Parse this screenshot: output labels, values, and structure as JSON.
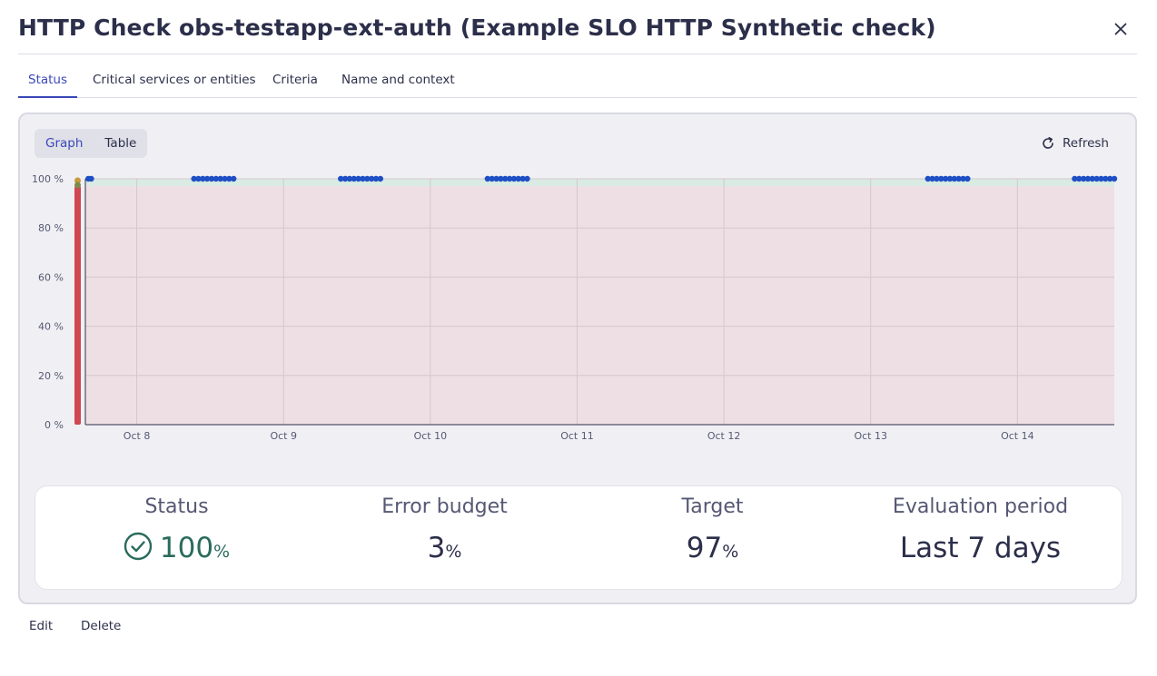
{
  "dialog": {
    "title": "HTTP Check obs-testapp-ext-auth (Example SLO HTTP Synthetic check)",
    "close_icon": "close-icon"
  },
  "tabs": [
    {
      "label": "Status",
      "active": true
    },
    {
      "label": "Critical services or entities",
      "active": false
    },
    {
      "label": "Criteria",
      "active": false
    },
    {
      "label": "Name and context",
      "active": false
    }
  ],
  "view_toggle": {
    "graph_label": "Graph",
    "table_label": "Table",
    "selected": "Graph"
  },
  "refresh": {
    "label": "Refresh",
    "icon": "refresh-icon"
  },
  "chart_data": {
    "type": "scatter",
    "y_ticks": [
      "100 %",
      "80 %",
      "60 %",
      "40 %",
      "20 %",
      "0 %"
    ],
    "ylim": [
      0,
      100
    ],
    "x_ticks": [
      "Oct 8",
      "Oct 9",
      "Oct 10",
      "Oct 11",
      "Oct 12",
      "Oct 13",
      "Oct 14"
    ],
    "xlim_days": [
      7.65,
      14.66
    ],
    "grid": true,
    "target_percent": 97,
    "colors": {
      "points": "#1f4fc4",
      "error_band": "#eddfe3",
      "ok_band": "#d9ebe3",
      "bar": "#d0474f"
    },
    "series": [
      {
        "values": [
          {
            "x": 7.67,
            "y": 100
          },
          {
            "x": 7.69,
            "y": 100
          },
          {
            "x": 8.39,
            "y": 100
          },
          {
            "x": 8.42,
            "y": 100
          },
          {
            "x": 8.45,
            "y": 100
          },
          {
            "x": 8.48,
            "y": 100
          },
          {
            "x": 8.51,
            "y": 100
          },
          {
            "x": 8.54,
            "y": 100
          },
          {
            "x": 8.57,
            "y": 100
          },
          {
            "x": 8.6,
            "y": 100
          },
          {
            "x": 8.63,
            "y": 100
          },
          {
            "x": 8.66,
            "y": 100
          },
          {
            "x": 9.39,
            "y": 100
          },
          {
            "x": 9.42,
            "y": 100
          },
          {
            "x": 9.45,
            "y": 100
          },
          {
            "x": 9.48,
            "y": 100
          },
          {
            "x": 9.51,
            "y": 100
          },
          {
            "x": 9.54,
            "y": 100
          },
          {
            "x": 9.57,
            "y": 100
          },
          {
            "x": 9.6,
            "y": 100
          },
          {
            "x": 9.63,
            "y": 100
          },
          {
            "x": 9.66,
            "y": 100
          },
          {
            "x": 10.39,
            "y": 100
          },
          {
            "x": 10.42,
            "y": 100
          },
          {
            "x": 10.45,
            "y": 100
          },
          {
            "x": 10.48,
            "y": 100
          },
          {
            "x": 10.51,
            "y": 100
          },
          {
            "x": 10.54,
            "y": 100
          },
          {
            "x": 10.57,
            "y": 100
          },
          {
            "x": 10.6,
            "y": 100
          },
          {
            "x": 10.63,
            "y": 100
          },
          {
            "x": 10.66,
            "y": 100
          },
          {
            "x": 13.39,
            "y": 100
          },
          {
            "x": 13.42,
            "y": 100
          },
          {
            "x": 13.45,
            "y": 100
          },
          {
            "x": 13.48,
            "y": 100
          },
          {
            "x": 13.51,
            "y": 100
          },
          {
            "x": 13.54,
            "y": 100
          },
          {
            "x": 13.57,
            "y": 100
          },
          {
            "x": 13.6,
            "y": 100
          },
          {
            "x": 13.63,
            "y": 100
          },
          {
            "x": 13.66,
            "y": 100
          },
          {
            "x": 14.39,
            "y": 100
          },
          {
            "x": 14.42,
            "y": 100
          },
          {
            "x": 14.45,
            "y": 100
          },
          {
            "x": 14.48,
            "y": 100
          },
          {
            "x": 14.51,
            "y": 100
          },
          {
            "x": 14.54,
            "y": 100
          },
          {
            "x": 14.57,
            "y": 100
          },
          {
            "x": 14.6,
            "y": 100
          },
          {
            "x": 14.63,
            "y": 100
          },
          {
            "x": 14.66,
            "y": 100
          }
        ]
      }
    ]
  },
  "kpis": {
    "status": {
      "label": "Status",
      "value": "100",
      "unit": "%",
      "icon": "check-circle-icon"
    },
    "error_budget": {
      "label": "Error budget",
      "value": "3",
      "unit": "%"
    },
    "target": {
      "label": "Target",
      "value": "97",
      "unit": "%"
    },
    "evaluation": {
      "label": "Evaluation period",
      "value": "Last 7 days"
    }
  },
  "footer": {
    "edit_label": "Edit",
    "delete_label": "Delete"
  }
}
